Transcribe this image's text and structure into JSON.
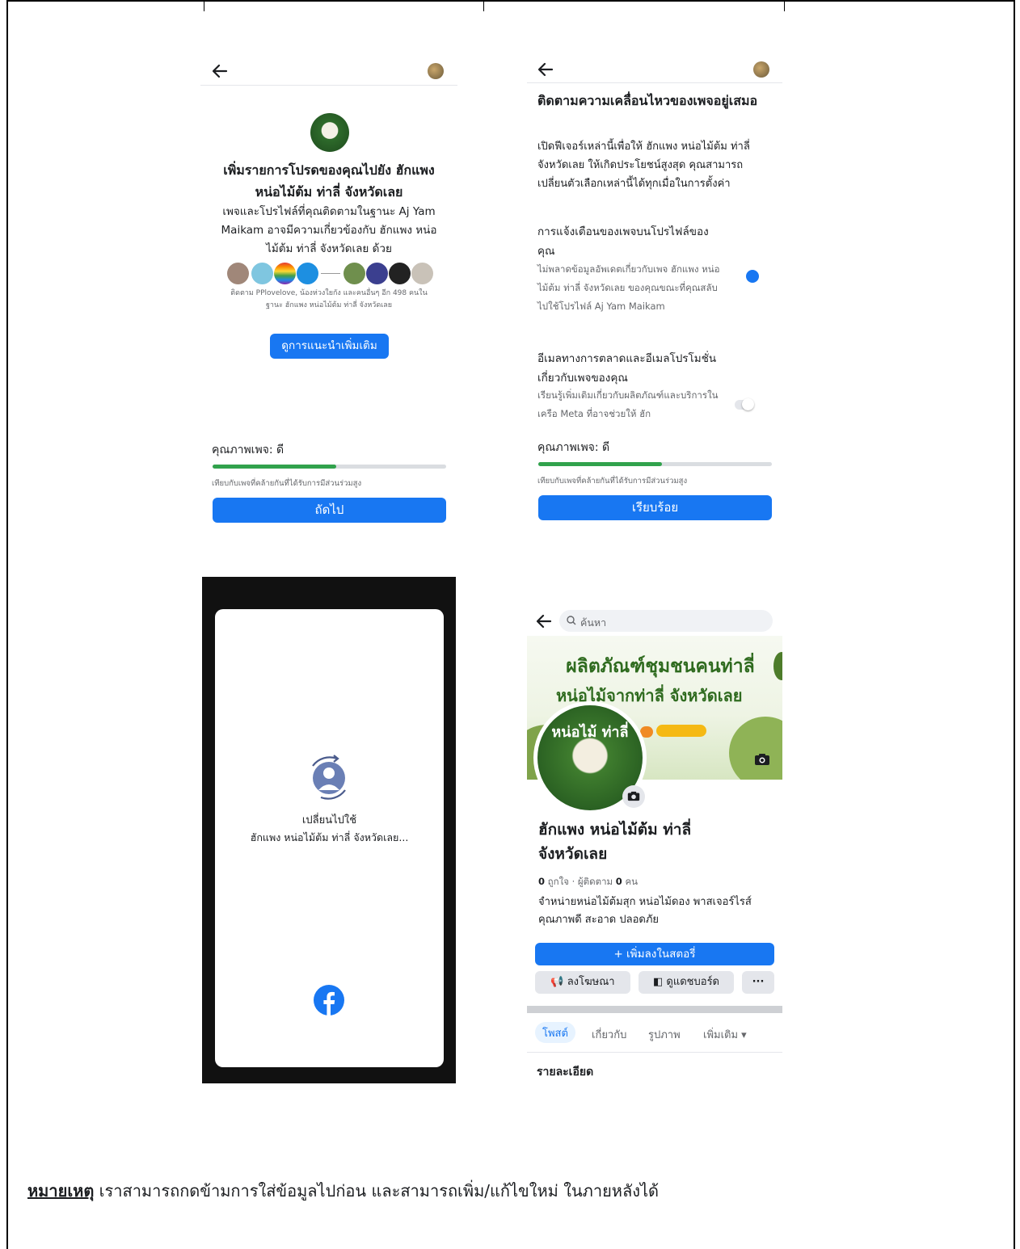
{
  "screen1": {
    "back_icon": "arrow-left-icon",
    "title": "เพิ่มรายการโปรดของคุณไปยัง ฮักแพง หน่อไม้ต้ม ท่าลี่ จังหวัดเลย",
    "desc": "เพจและโปรไฟล์ที่คุณติดตามในฐานะ Aj Yam Maikam อาจมีความเกี่ยวข้องกับ ฮักแพง หน่อไม้ต้ม ท่าลี่ จังหวัดเลย ด้วย",
    "follow_note": "ติดตาม PPlovelove, น้องห่วงใยกัง และคนอื่นๆ อีก 498 คนในฐานะ ฮักแพง หน่อไม้ต้ม ท่าลี่ จังหวัดเลย",
    "see_more_button": "ดูการแนะนำเพิ่มเติม",
    "quality_label": "คุณภาพเพจ: ดี",
    "quality_fraction": 0.53,
    "quality_note": "เทียบกับเพจที่คล้ายกันที่ได้รับการมีส่วนร่วมสูง",
    "next_button": "ถัดไป"
  },
  "screen2": {
    "back_icon": "arrow-left-icon",
    "title": "ติดตามความเคลื่อนไหวของเพจอยู่เสมอ",
    "desc": "เปิดฟีเจอร์เหล่านี้เพื่อให้ ฮักแพง หน่อไม้ต้ม ท่าลี่ จังหวัดเลย ให้เกิดประโยชน์สูงสุด คุณสามารถเปลี่ยนตัวเลือกเหล่านี้ได้ทุกเมื่อในการตั้งค่า",
    "setting1_title": "การแจ้งเตือนของเพจบนโปรไฟล์ของคุณ",
    "setting1_desc": "ไม่พลาดข้อมูลอัพเดตเกี่ยวกับเพจ ฮักแพง หน่อไม้ต้ม ท่าลี่ จังหวัดเลย ของคุณขณะที่คุณสลับไปใช้โปรไฟล์ Aj Yam Maikam",
    "setting1_on": true,
    "setting2_title": "อีเมลทางการตลาดและอีเมลโปรโมชั่นเกี่ยวกับเพจของคุณ",
    "setting2_desc": "เรียนรู้เพิ่มเติมเกี่ยวกับผลิตภัณฑ์และบริการในเครือ Meta ที่อาจช่วยให้ ฮัก",
    "setting2_on": false,
    "quality_label": "คุณภาพเพจ: ดี",
    "quality_fraction": 0.53,
    "quality_note": "เทียบกับเพจที่คล้ายกันที่ได้รับการมีส่วนร่วมสูง",
    "done_button": "เรียบร้อย"
  },
  "screen3": {
    "switch_line1": "เปลี่ยนไปใช้",
    "switch_line2": "ฮักแพง หน่อไม้ต้ม ท่าลี่ จังหวัดเลย..."
  },
  "screen4": {
    "search_placeholder": "ค้นหา",
    "cover_line1": "ผลิตภัณฑ์ชุมชนคนท่าลี่",
    "cover_line2": "หน่อไม้จากท่าลี่ จังหวัดเลย",
    "logo_text": "หน่อไม้ ท่าลี่",
    "page_name": "ฮักแพง หน่อไม้ต้ม ท่าลี่ จังหวัดเลย",
    "likes": "0",
    "likes_label": "ถูกใจ",
    "followers_label": "ผู้ติดตาม",
    "followers": "0",
    "followers_unit": "คน",
    "bio": "จำหน่ายหน่อไม้ต้มสุก หน่อไม้ดอง พาสเจอร์ไรส์ คุณภาพดี สะอาด ปลอดภัย",
    "add_story_button": "+ เพิ่มลงในสตอรี่",
    "advertise_button": "ลงโฆษณา",
    "dashboard_button": "ดูแดชบอร์ด",
    "more_button": "···",
    "tabs": [
      "โพสต์",
      "เกี่ยวกับ",
      "รูปภาพ",
      "เพิ่มเติม ▾"
    ],
    "details_heading": "รายละเอียด"
  },
  "note": {
    "label": "หมายเหตุ",
    "text": " เราสามารถกดข้ามการใส่ข้อมูลไปก่อน และสามารถเพิ่ม/แก้ไขใหม่ ในภายหลังได้"
  },
  "colors": {
    "facebook_blue": "#1877f2",
    "quality_green": "#31a24c"
  }
}
